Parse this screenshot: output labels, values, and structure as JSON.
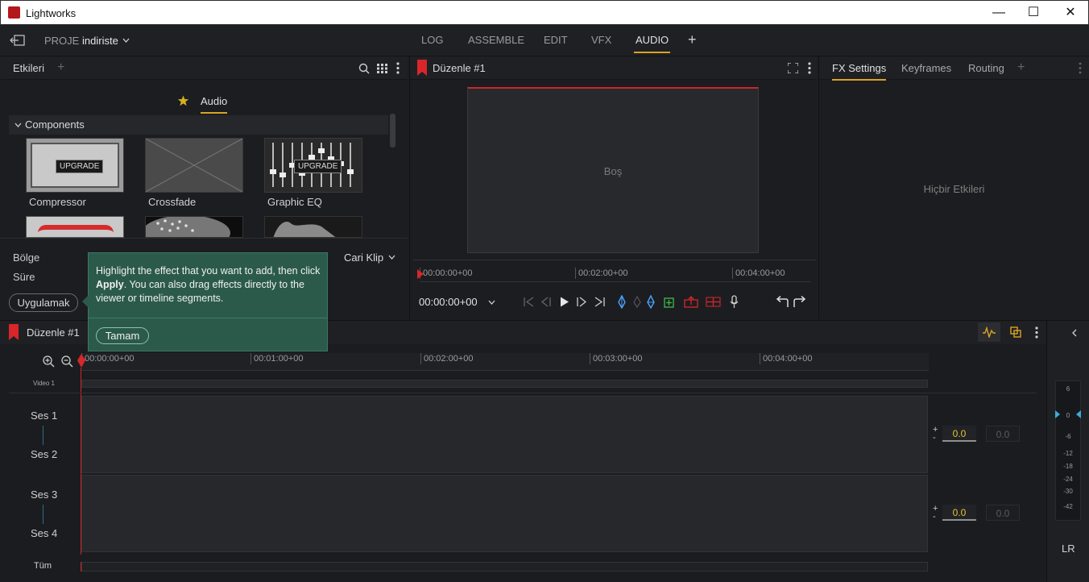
{
  "window": {
    "title": "Lightworks",
    "minimize": "—",
    "maximize": "☐",
    "close": "✕"
  },
  "nav": {
    "back_icon": "exit-icon",
    "project_label": "PROJE",
    "project_name": "indiriste",
    "tabs": [
      "LOG",
      "ASSEMBLE",
      "EDIT",
      "VFX",
      "AUDIO"
    ],
    "active_tab": "AUDIO",
    "add": "+"
  },
  "effects_panel": {
    "title": "Etkileri",
    "add": "+",
    "category": "Audio",
    "section": "Components",
    "items": [
      {
        "label": "Compressor",
        "badge": "UPGRADE"
      },
      {
        "label": "Crossfade",
        "badge": ""
      },
      {
        "label": "Graphic EQ",
        "badge": "UPGRADE"
      }
    ],
    "region_label": "Bölge",
    "duration_label": "Süre",
    "current_clip": "Cari Klip",
    "apply_button": "Uygulamak"
  },
  "tooltip": {
    "text_before": "Highlight the effect that you want to add, then click ",
    "bold": "Apply",
    "text_after": ".  You can also drag effects directly to the viewer or timeline segments.",
    "ok_button": "Tamam"
  },
  "viewer": {
    "title": "Düzenle #1",
    "empty_label": "Boş",
    "ruler": [
      "00:00:00+00",
      "00:02:00+00",
      "00:04:00+00"
    ],
    "timecode": "00:00:00+00"
  },
  "fx_panel": {
    "tabs": [
      "FX Settings",
      "Keyframes",
      "Routing"
    ],
    "active_tab": "FX Settings",
    "add": "+",
    "empty_label": "Hiçbir Etkileri"
  },
  "timeline": {
    "title": "Düzenle #1",
    "ruler": [
      "00:00:00+00",
      "00:01:00+00",
      "00:02:00+00",
      "00:03:00+00",
      "00:04:00+00"
    ],
    "video_track": "Video 1",
    "audio_tracks": [
      "Ses 1",
      "Ses 2",
      "Ses 3",
      "Ses 4"
    ],
    "all_label": "Tüm",
    "volume_values": [
      "0.0",
      "0.0",
      "0.0",
      "0.0"
    ],
    "meter_scale": [
      "6",
      "0",
      "-6",
      "-12",
      "-18",
      "-24",
      "-30",
      "-42"
    ],
    "meter_channels": "LR"
  },
  "colors": {
    "accent": "#d9a425",
    "record_red": "#d8262b",
    "tooltip_bg": "#2b5a4b"
  }
}
